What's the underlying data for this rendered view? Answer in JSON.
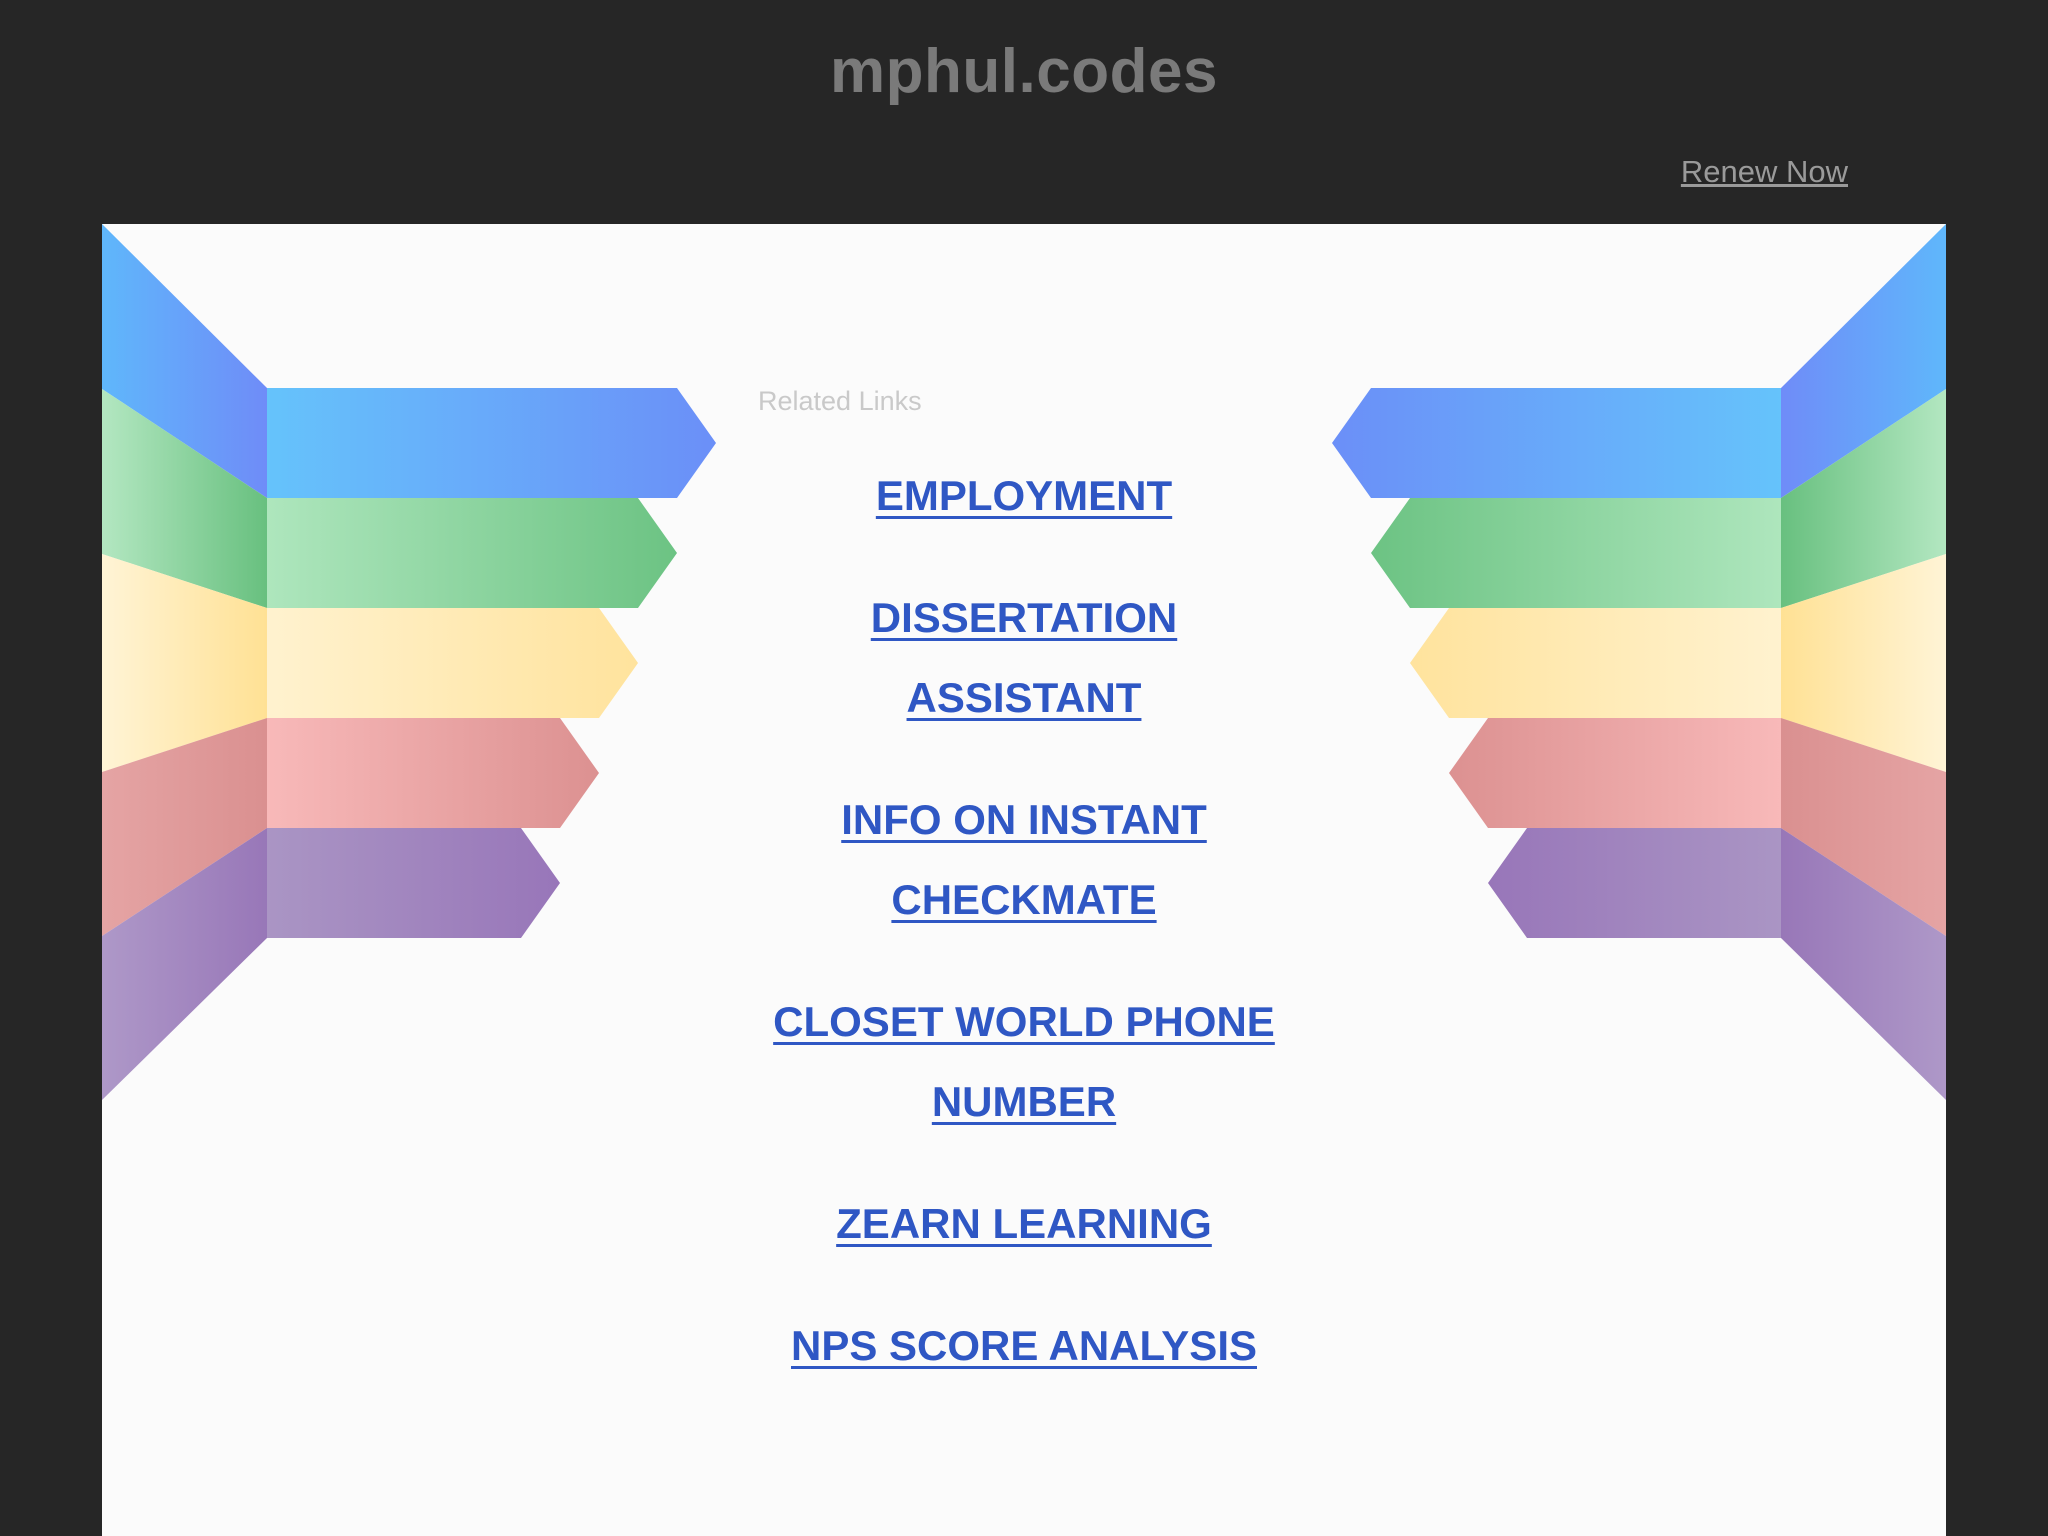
{
  "header": {
    "domain_title": "mphul.codes",
    "renew_label": "Renew Now"
  },
  "related": {
    "label": "Related Links",
    "links": [
      {
        "lines": [
          "EMPLOYMENT"
        ]
      },
      {
        "lines": [
          "DISSERTATION",
          "ASSISTANT"
        ]
      },
      {
        "lines": [
          "INFO ON INSTANT",
          "CHECKMATE"
        ]
      },
      {
        "lines": [
          "CLOSET WORLD PHONE",
          "NUMBER"
        ]
      },
      {
        "lines": [
          "ZEARN LEARNING"
        ]
      },
      {
        "lines": [
          "NPS SCORE ANALYSIS"
        ]
      }
    ]
  },
  "colors": {
    "background": "#262626",
    "panel": "#fbfbfb",
    "link": "#2f57c4",
    "stripe_blue": "#67b9f8",
    "stripe_green": "#76c98b",
    "stripe_yellow": "#ffe5a3",
    "stripe_red": "#e59c9c",
    "stripe_purple": "#a185c0"
  }
}
